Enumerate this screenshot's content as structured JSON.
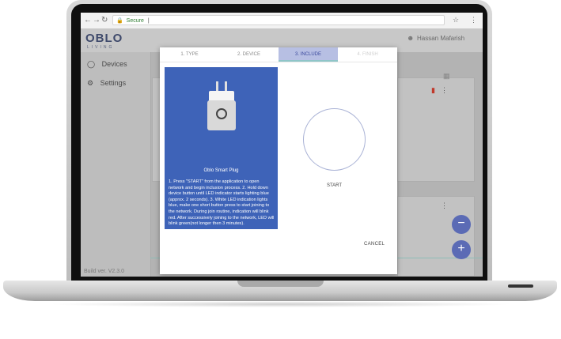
{
  "browser": {
    "address_secure": "Secure",
    "address_text": "|"
  },
  "app": {
    "logo": "OBLO",
    "logo_sub": "LIVING",
    "user_name": "Hassan Mafarish",
    "sidebar": [
      {
        "label": "Devices",
        "icon": "lightbulb-icon"
      },
      {
        "label": "Settings",
        "icon": "gear-icon"
      }
    ],
    "build": "Build ver. V2.3.0"
  },
  "wizard": {
    "tabs": [
      {
        "label": "1. TYPE",
        "state": "done"
      },
      {
        "label": "2. DEVICE",
        "state": "done"
      },
      {
        "label": "3. INCLUDE",
        "state": "active"
      },
      {
        "label": "4. FINISH",
        "state": "disabled"
      }
    ],
    "device_name": "Oblo Smart Plug",
    "instructions": "1. Press \"START\" from the application to open network and begin inclusion process. 2. Hold down device button until LED indicator starts lighting blue (approx. 2 seconds). 3. White LED indication lights blue, make one short button press to start joining to the network. During join routine, indication will blink red. After successively joining to the network, LED will blink green(not longer then 3 minutes).",
    "start_label": "START",
    "cancel_label": "CANCEL"
  },
  "colors": {
    "accent": "#3e63b8",
    "fab": "#5b6bb5"
  }
}
